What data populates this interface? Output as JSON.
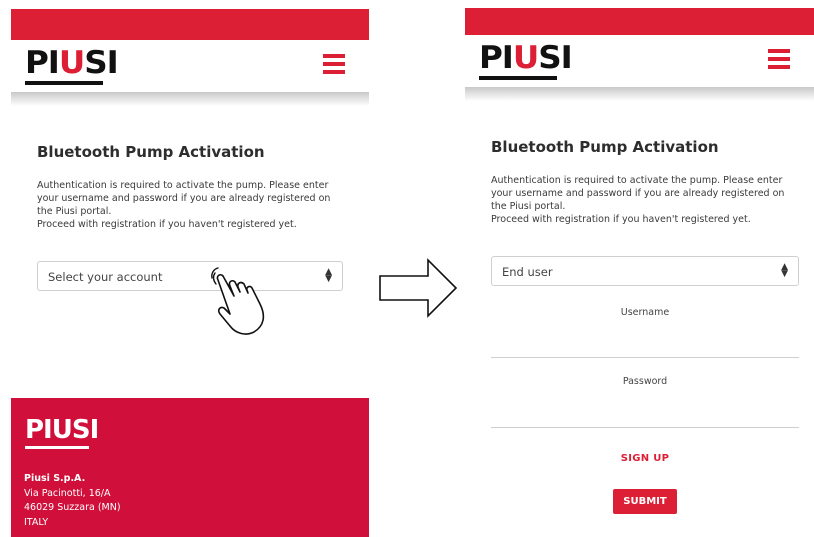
{
  "brand": {
    "logo_text": "PIUSI",
    "accent_color": "#dc1f35",
    "footer_color": "#d0103a"
  },
  "left_screen": {
    "title": "Bluetooth Pump Activation",
    "description_line1": "Authentication is required to activate the pump. Please enter your username and password if you are already registered on the Piusi portal.",
    "description_line2": "Proceed with registration if you haven't registered yet.",
    "select_value": "Select your account",
    "footer": {
      "company": "Piusi S.p.A.",
      "street": "Via Pacinotti, 16/A",
      "city": "46029 Suzzara (MN)",
      "country": "ITALY"
    }
  },
  "right_screen": {
    "title": "Bluetooth Pump Activation",
    "description_line1": "Authentication is required to activate the pump. Please enter your username and password if you are already registered on the Piusi portal.",
    "description_line2": "Proceed with registration if you haven't registered yet.",
    "select_value": "End user",
    "username_label": "Username",
    "password_label": "Password",
    "signup_label": "SIGN UP",
    "submit_label": "SUBMIT"
  },
  "icons": {
    "menu": "hamburger-menu-icon",
    "select_arrows": "updown-arrows-icon",
    "hand": "tap-hand-icon",
    "arrow": "right-arrow-icon"
  }
}
